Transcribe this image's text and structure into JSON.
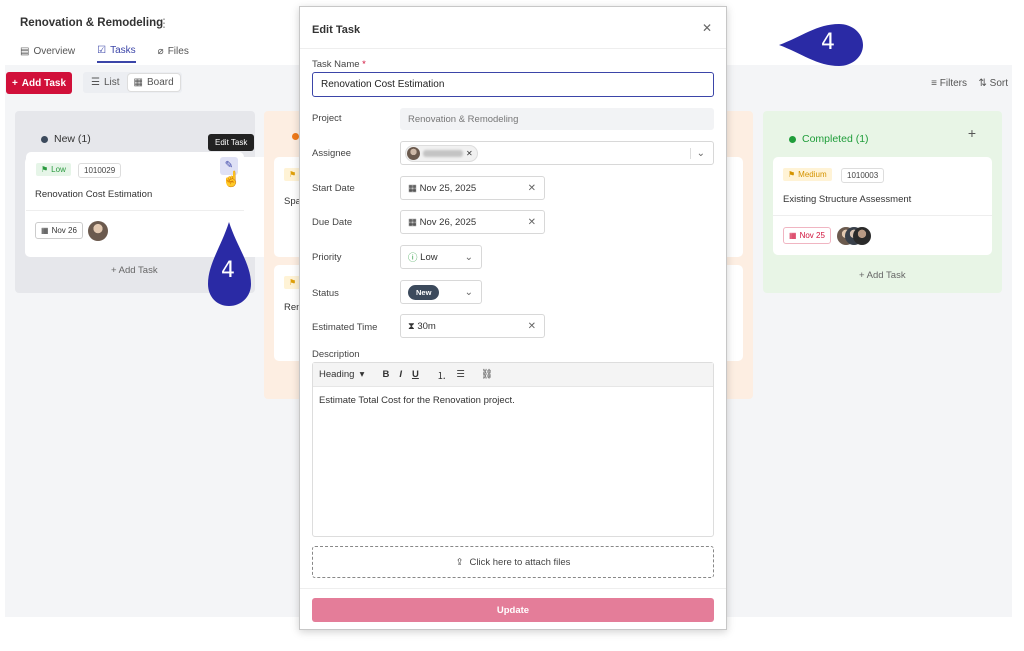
{
  "project": {
    "title": "Renovation & Remodeling",
    "menu_icon": "kebab-icon"
  },
  "tabs": [
    {
      "label": "Overview",
      "icon": "clipboard-icon"
    },
    {
      "label": "Tasks",
      "icon": "checkbox-icon",
      "active": true
    },
    {
      "label": "Files",
      "icon": "paperclip-icon"
    }
  ],
  "toolbar": {
    "add_task": "Add Task",
    "list": "List",
    "board": "Board",
    "filters": "Filters",
    "sort": "Sort"
  },
  "columns": {
    "new": {
      "title": "New (1)",
      "color": "#3c4a5c",
      "add_label": "+ Add Task",
      "card": {
        "priority": "Low",
        "id": "1010029",
        "title": "Renovation Cost Estimation",
        "date": "Nov 26"
      }
    },
    "completed": {
      "title": "Completed (1)",
      "color": "#1f9d3a",
      "add_label": "+ Add Task",
      "card": {
        "priority": "Medium",
        "id": "1010003",
        "title": "Existing Structure Assessment",
        "date": "Nov 25"
      }
    },
    "in_progress": {
      "color": "#f07a1a",
      "card1_title_partial": "Spa",
      "card2_title_partial": "Ren"
    }
  },
  "tooltip": "Edit Task",
  "markers": [
    {
      "number": "4"
    },
    {
      "number": "4"
    }
  ],
  "modal": {
    "title": "Edit Task",
    "task_name_label": "Task Name",
    "required_mark": "*",
    "task_name_value": "Renovation Cost Estimation",
    "project_label": "Project",
    "project_value": "Renovation & Remodeling",
    "assignee_label": "Assignee",
    "start_date_label": "Start Date",
    "start_date_value": "Nov 25, 2025",
    "due_date_label": "Due Date",
    "due_date_value": "Nov 26, 2025",
    "priority_label": "Priority",
    "priority_value": "Low",
    "status_label": "Status",
    "status_value": "New",
    "estimated_time_label": "Estimated Time",
    "estimated_time_value": "30m",
    "description_label": "Description",
    "editor_heading": "Heading",
    "description_value": "Estimate Total Cost for the Renovation project.",
    "attach_label": "Click here to attach files",
    "update_label": "Update"
  },
  "colors": {
    "brand_red": "#d1103a",
    "accent_blue": "#3b45a8",
    "marker": "#2a2aa5",
    "update_btn": "#e47d99"
  }
}
